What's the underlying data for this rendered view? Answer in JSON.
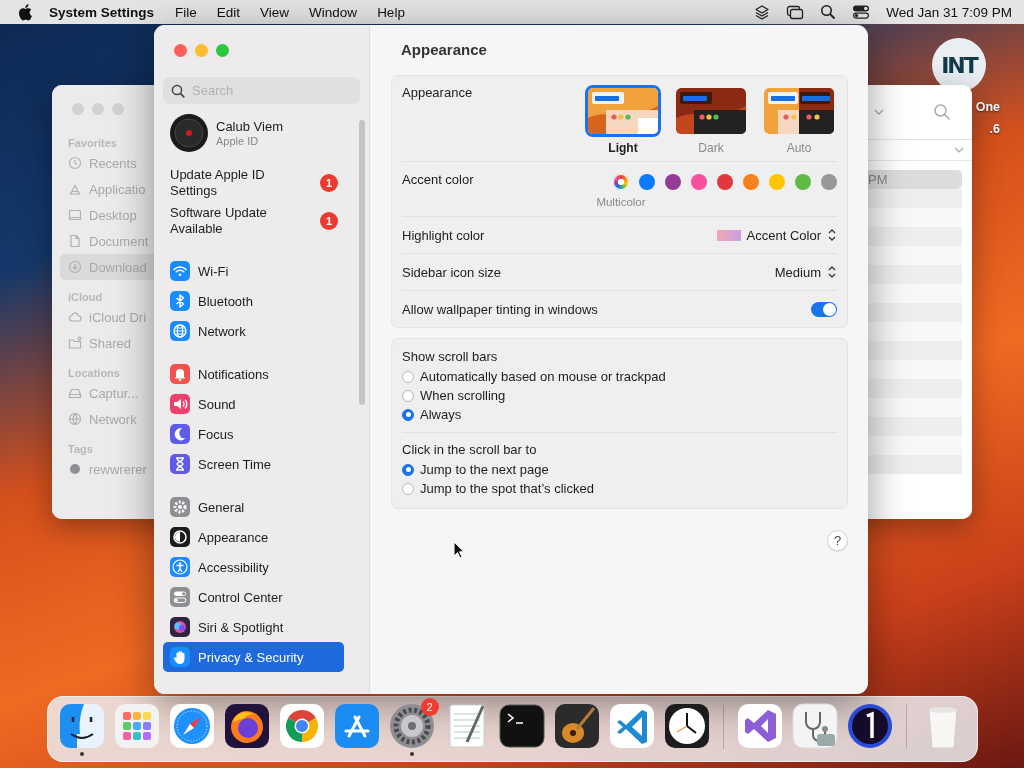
{
  "menu_bar": {
    "app_name": "System Settings",
    "menus": [
      "File",
      "Edit",
      "View",
      "Window",
      "Help"
    ],
    "clock": "Wed Jan 31  7:09 PM"
  },
  "desktop_icon": {
    "logo_text": "INT",
    "label_lines": [
      "One",
      ".6"
    ]
  },
  "finder": {
    "sections": [
      {
        "title": "Favorites",
        "items": [
          {
            "label": "Recents",
            "selected": false
          },
          {
            "label": "Applicatio",
            "selected": false
          },
          {
            "label": "Desktop",
            "selected": false
          },
          {
            "label": "Document",
            "selected": false
          },
          {
            "label": "Download",
            "selected": true
          }
        ]
      },
      {
        "title": "iCloud",
        "items": [
          {
            "label": "iCloud Dri",
            "selected": false
          },
          {
            "label": "Shared",
            "selected": false
          }
        ]
      },
      {
        "title": "Locations",
        "items": [
          {
            "label": "Captur...",
            "selected": false
          },
          {
            "label": "Network",
            "selected": false
          }
        ]
      },
      {
        "title": "Tags",
        "items": [
          {
            "label": "rewwrerer",
            "selected": false,
            "color": "#8e8e93"
          }
        ]
      }
    ],
    "rows": [
      {
        "text": "PM",
        "selected": true
      },
      {
        "selected": false
      },
      {
        "selected": false
      },
      {
        "selected": false
      },
      {
        "selected": false
      },
      {
        "selected": false
      },
      {
        "selected": false
      },
      {
        "selected": false
      },
      {
        "selected": false
      },
      {
        "selected": false
      },
      {
        "selected": false
      },
      {
        "selected": false
      },
      {
        "selected": false
      },
      {
        "selected": false
      },
      {
        "selected": false
      },
      {
        "selected": false
      }
    ]
  },
  "settings": {
    "sidebar": {
      "search_placeholder": "Search",
      "account": {
        "name": "Calub Viem",
        "subtitle": "Apple ID"
      },
      "notices": [
        {
          "text": "Update Apple ID Settings",
          "badge": "1"
        },
        {
          "text": "Software Update Available",
          "badge": "1"
        }
      ],
      "groups": [
        {
          "items": [
            {
              "label": "Wi-Fi",
              "color": "#1a8cff",
              "selected": false
            },
            {
              "label": "Bluetooth",
              "color": "#1a8cff",
              "selected": false
            },
            {
              "label": "Network",
              "color": "#1a8cff",
              "selected": false
            }
          ]
        },
        {
          "items": [
            {
              "label": "Notifications",
              "color": "#f2524d",
              "selected": false
            },
            {
              "label": "Sound",
              "color": "#ef3f6b",
              "selected": false
            },
            {
              "label": "Focus",
              "color": "#5e5ce6",
              "selected": false
            },
            {
              "label": "Screen Time",
              "color": "#5e5ce6",
              "selected": false
            }
          ]
        },
        {
          "items": [
            {
              "label": "General",
              "color": "#8e8e93",
              "selected": false
            },
            {
              "label": "Appearance",
              "color": "#1c1c1e",
              "selected": false
            },
            {
              "label": "Accessibility",
              "color": "#1a8cff",
              "selected": false
            },
            {
              "label": "Control Center",
              "color": "#8e8e93",
              "selected": false
            },
            {
              "label": "Siri & Spotlight",
              "color": "#2e2440",
              "selected": false
            },
            {
              "label": "Privacy & Security",
              "color": "#1a8cff",
              "selected": true
            }
          ]
        }
      ]
    },
    "pane": {
      "title": "Appearance",
      "appearance": {
        "label": "Appearance",
        "options": [
          {
            "label": "Light",
            "kind": "light",
            "selected": true
          },
          {
            "label": "Dark",
            "kind": "dark",
            "selected": false
          },
          {
            "label": "Auto",
            "kind": "auto",
            "selected": false
          }
        ]
      },
      "accent": {
        "label": "Accent color",
        "caption": "Multicolor",
        "swatches": [
          {
            "kind": "multicolor",
            "selected": true
          },
          {
            "kind": "solid",
            "color": "#0a7aff",
            "selected": false
          },
          {
            "kind": "solid",
            "color": "#953d96",
            "selected": false
          },
          {
            "kind": "solid",
            "color": "#f74f9e",
            "selected": false
          },
          {
            "kind": "solid",
            "color": "#e0383e",
            "selected": false
          },
          {
            "kind": "solid",
            "color": "#f7821b",
            "selected": false
          },
          {
            "kind": "solid",
            "color": "#ffc600",
            "selected": false
          },
          {
            "kind": "solid",
            "color": "#62ba46",
            "selected": false
          },
          {
            "kind": "solid",
            "color": "#989898",
            "selected": false
          }
        ]
      },
      "highlight": {
        "label": "Highlight color",
        "value": "Accent Color"
      },
      "icon_size": {
        "label": "Sidebar icon size",
        "value": "Medium"
      },
      "tinting": {
        "label": "Allow wallpaper tinting in windows",
        "on": true
      },
      "scroll_bars": {
        "label": "Show scroll bars",
        "options": [
          {
            "label": "Automatically based on mouse or trackpad",
            "selected": false
          },
          {
            "label": "When scrolling",
            "selected": false
          },
          {
            "label": "Always",
            "selected": true
          }
        ]
      },
      "click_scroll": {
        "label": "Click in the scroll bar to",
        "options": [
          {
            "label": "Jump to the next page",
            "selected": true
          },
          {
            "label": "Jump to the spot that’s clicked",
            "selected": false
          }
        ]
      },
      "help": "?"
    }
  },
  "dock": {
    "apps": [
      {
        "running": true
      },
      {
        "running": false
      },
      {
        "running": false
      },
      {
        "running": false
      },
      {
        "running": false
      },
      {
        "running": false
      },
      {
        "running": true,
        "badge": "2"
      },
      {
        "running": false
      },
      {
        "running": false
      },
      {
        "running": false
      },
      {
        "running": false
      },
      {
        "running": false
      }
    ],
    "extras": [
      {
        "running": false
      },
      {
        "running": false
      },
      {
        "running": false
      }
    ]
  }
}
